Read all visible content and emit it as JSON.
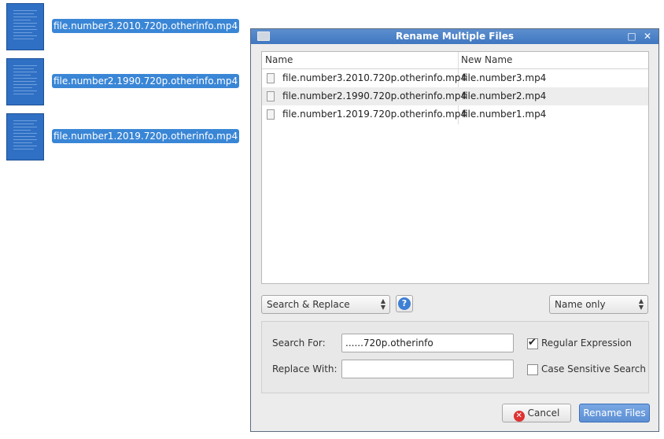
{
  "desktop": {
    "files": [
      {
        "label": "file.number3.2010.720p.otherinfo.mp4"
      },
      {
        "label": "file.number2.1990.720p.otherinfo.mp4"
      },
      {
        "label": "file.number1.2019.720p.otherinfo.mp4"
      }
    ]
  },
  "dialog": {
    "title": "Rename Multiple Files",
    "columns": {
      "name": "Name",
      "new_name": "New Name"
    },
    "rows": [
      {
        "name": "file.number3.2010.720p.otherinfo.mp4",
        "new_name": "file.number3.mp4"
      },
      {
        "name": "file.number2.1990.720p.otherinfo.mp4",
        "new_name": "file.number2.mp4"
      },
      {
        "name": "file.number1.2019.720p.otherinfo.mp4",
        "new_name": "file.number1.mp4"
      }
    ],
    "mode_select": {
      "value": "Search & Replace"
    },
    "scope_select": {
      "value": "Name only"
    },
    "search_label": "Search For:",
    "search_value": "......720p.otherinfo",
    "replace_label": "Replace With:",
    "replace_value": "",
    "regex_label": "Regular Expression",
    "regex_checked": true,
    "case_label": "Case Sensitive Search",
    "case_checked": false,
    "cancel_label": "Cancel",
    "rename_label": "Rename Files"
  },
  "colors": {
    "accent": "#3a86d6",
    "titlebar": "#4f84c8"
  }
}
